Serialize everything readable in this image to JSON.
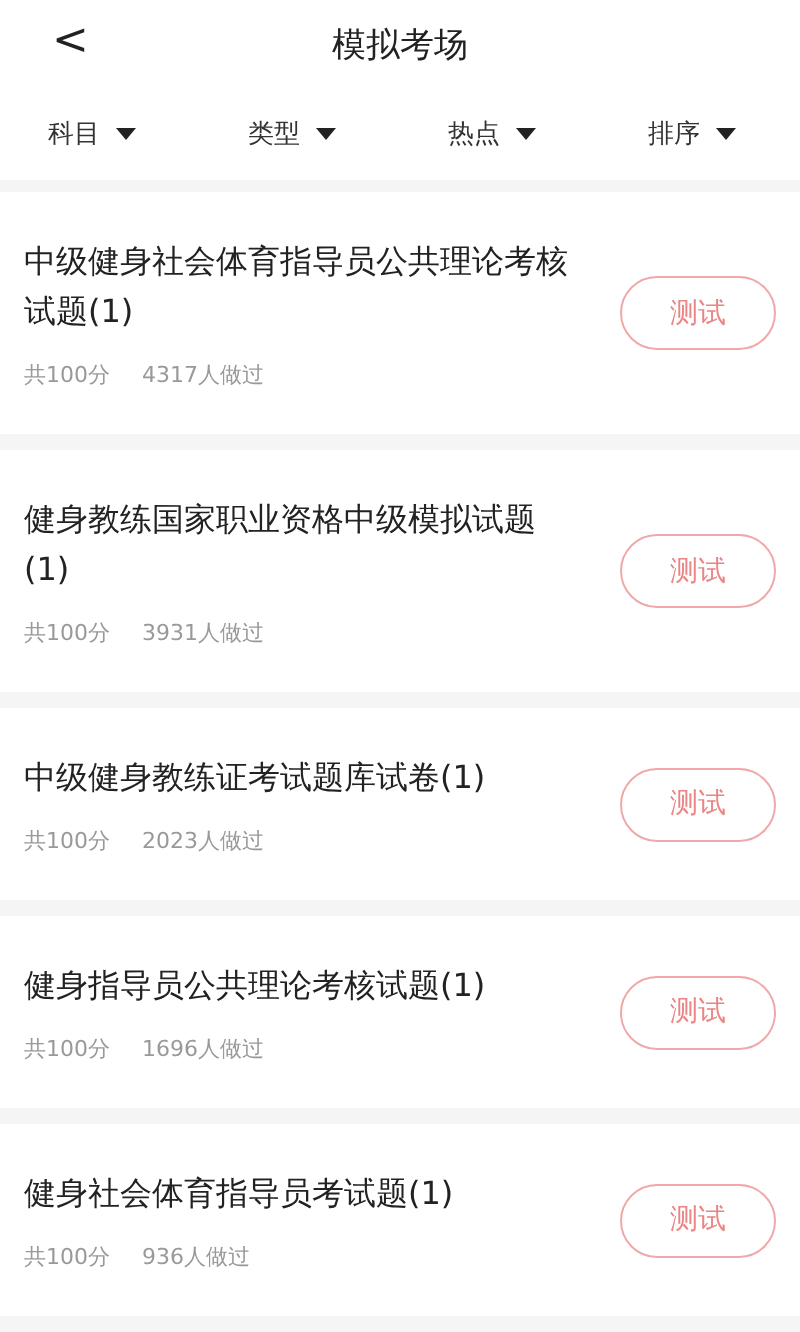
{
  "header": {
    "back": "<",
    "title": "模拟考场"
  },
  "filters": [
    {
      "label": "科目"
    },
    {
      "label": "类型"
    },
    {
      "label": "热点"
    },
    {
      "label": "排序"
    }
  ],
  "exams": [
    {
      "title": "中级健身社会体育指导员公共理论考核试题(1)",
      "score": "共100分",
      "taken": "4317人做过",
      "button": "测试"
    },
    {
      "title": "健身教练国家职业资格中级模拟试题(1)",
      "score": "共100分",
      "taken": "3931人做过",
      "button": "测试"
    },
    {
      "title": "中级健身教练证考试题库试卷(1)",
      "score": "共100分",
      "taken": "2023人做过",
      "button": "测试"
    },
    {
      "title": "健身指导员公共理论考核试题(1)",
      "score": "共100分",
      "taken": "1696人做过",
      "button": "测试"
    },
    {
      "title": "健身社会体育指导员考试题(1)",
      "score": "共100分",
      "taken": "936人做过",
      "button": "测试"
    }
  ]
}
